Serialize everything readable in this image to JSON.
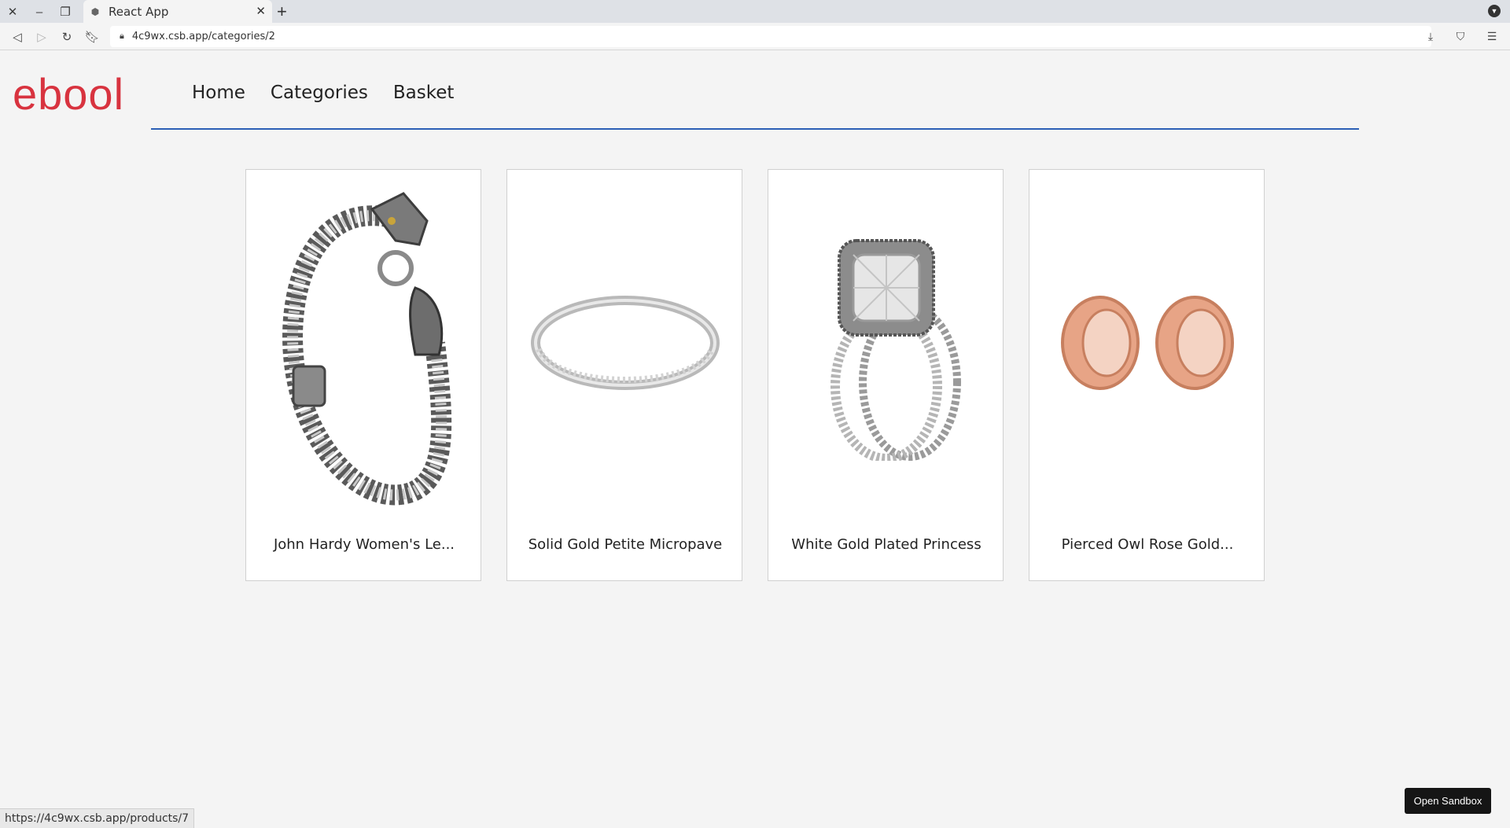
{
  "browser": {
    "tab": {
      "title": "React App"
    },
    "url": "4c9wx.csb.app/categories/2",
    "status_url": "https://4c9wx.csb.app/products/7"
  },
  "site": {
    "brand": "ebool",
    "brand_color": "#d8333f",
    "nav": [
      {
        "label": "Home"
      },
      {
        "label": "Categories"
      },
      {
        "label": "Basket"
      }
    ],
    "nav_rule_color": "#2b5fb6"
  },
  "products": [
    {
      "title": "John Hardy Women's Le...",
      "image": "dragon-chain-bracelet"
    },
    {
      "title": "Solid Gold Petite Micropave",
      "image": "silver-band-ring"
    },
    {
      "title": "White Gold Plated Princess",
      "image": "princess-cut-ring-set"
    },
    {
      "title": "Pierced Owl Rose Gold...",
      "image": "rose-gold-tunnel-plugs"
    }
  ],
  "sandbox_button": "Open Sandbox"
}
